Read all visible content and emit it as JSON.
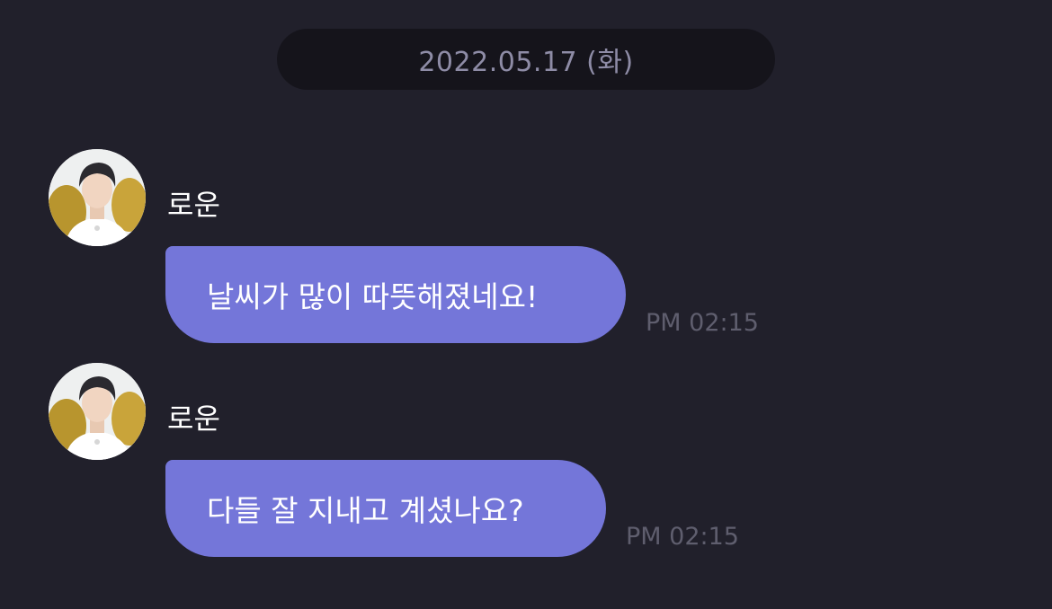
{
  "chat": {
    "date_separator": "2022.05.17 (화)",
    "messages": [
      {
        "sender": "로운",
        "text": "날씨가 많이 따뜻해졌네요!",
        "time": "PM 02:15",
        "avatar_icon": "profile-avatar"
      },
      {
        "sender": "로운",
        "text": "다들 잘 지내고 계셨나요?",
        "time": "PM 02:15",
        "avatar_icon": "profile-avatar"
      }
    ]
  },
  "colors": {
    "background": "#21202b",
    "date_pill": "#15141b",
    "bubble": "#7476d9",
    "time_text": "#5f5e6e"
  }
}
